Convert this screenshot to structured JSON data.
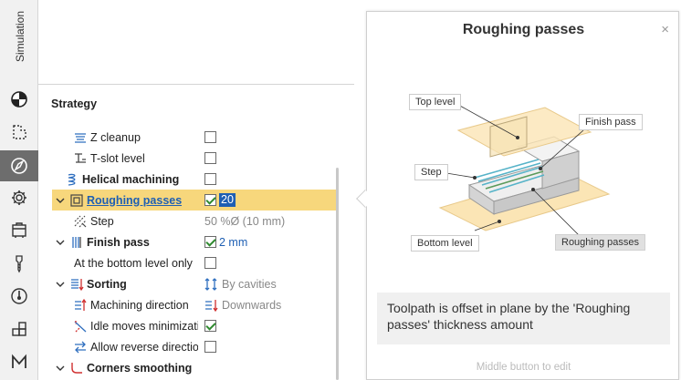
{
  "toolbar": {
    "vertical_tab": "Simulation",
    "buttons": [
      {
        "icon": "pie-chart-icon",
        "active": false
      },
      {
        "icon": "dashed-region-icon",
        "active": false
      },
      {
        "icon": "compass-icon",
        "active": true
      },
      {
        "icon": "gear-icon",
        "active": false
      },
      {
        "icon": "machine-icon",
        "active": false
      },
      {
        "icon": "tool-icon",
        "active": false
      },
      {
        "icon": "target-icon",
        "active": false
      },
      {
        "icon": "blocks-icon",
        "active": false
      },
      {
        "icon": "macro-m-icon",
        "active": false
      }
    ]
  },
  "panel": {
    "section_title": "Strategy",
    "rows": [
      {
        "label": "Z cleanup",
        "checked": false
      },
      {
        "label": "T-slot level",
        "checked": false
      },
      {
        "label": "Helical machining",
        "checked": false
      },
      {
        "label": "Roughing passes",
        "checked": true,
        "value": "20"
      },
      {
        "label": "Step",
        "value": "50 %Ø (10 mm)"
      },
      {
        "label": "Finish pass",
        "checked": true,
        "value": "2 mm"
      },
      {
        "label": "At the bottom level only",
        "checked": false
      },
      {
        "label": "Sorting",
        "value": "By cavities"
      },
      {
        "label": "Machining direction",
        "value": "Downwards"
      },
      {
        "label": "Idle moves minimization",
        "checked": true
      },
      {
        "label": "Allow reverse direction",
        "checked": false
      },
      {
        "label": "Corners smoothing"
      }
    ]
  },
  "help": {
    "title": "Roughing passes",
    "close": "×",
    "labels": {
      "top_level": "Top level",
      "finish_pass": "Finish pass",
      "step": "Step",
      "bottom_level": "Bottom level",
      "roughing_passes": "Roughing passes"
    },
    "description": "Toolpath is offset in plane by the 'Roughing passes' thickness amount",
    "footer": "Middle button to edit"
  },
  "colors": {
    "selection": "#f7d77c",
    "link": "#1e5fb3",
    "active_tool": "#6d6d6d",
    "level_plane": "#fbe5b5"
  }
}
